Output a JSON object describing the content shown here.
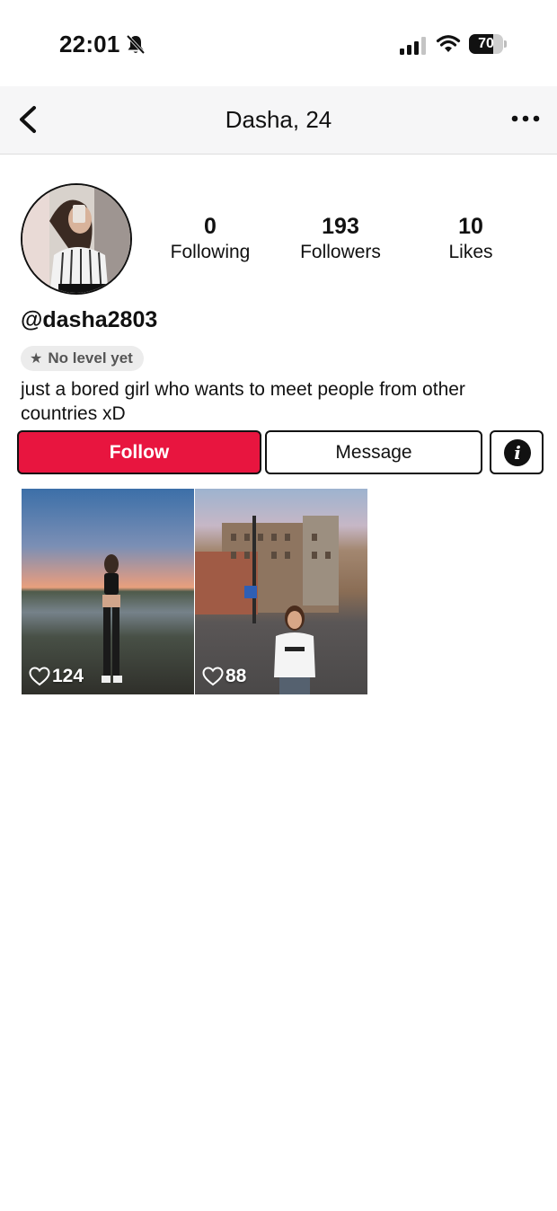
{
  "status_bar": {
    "time": "22:01",
    "battery": "70",
    "battery_level": 0.7,
    "icons": [
      "bell-slash-icon",
      "cellular-signal-icon",
      "wifi-icon",
      "battery-icon"
    ]
  },
  "nav": {
    "title": "Dasha, 24",
    "back_icon": "chevron-left-icon",
    "more_icon": "ellipsis-icon"
  },
  "profile": {
    "stats": [
      {
        "value": "0",
        "label": "Following"
      },
      {
        "value": "193",
        "label": "Followers"
      },
      {
        "value": "10",
        "label": "Likes"
      }
    ],
    "username": "@dasha2803",
    "level_badge": "No level yet",
    "bio": "just a bored girl who wants to meet people from other countries xD"
  },
  "actions": {
    "follow_label": "Follow",
    "message_label": "Message",
    "info_icon": "info-icon",
    "follow_color": "#e8153f"
  },
  "posts": [
    {
      "likes": "124"
    },
    {
      "likes": "88"
    }
  ]
}
